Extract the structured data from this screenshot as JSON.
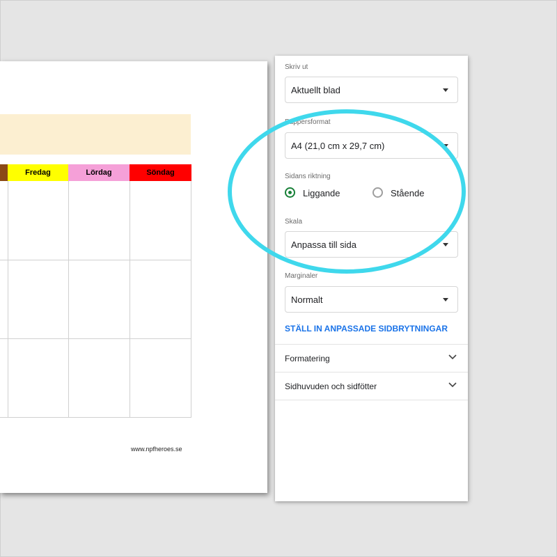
{
  "preview": {
    "days": [
      {
        "label": "",
        "color": "#8b4a17"
      },
      {
        "label": "Fredag",
        "color": "#ffff00"
      },
      {
        "label": "Lördag",
        "color": "#f5a0d8"
      },
      {
        "label": "Söndag",
        "color": "#ff0000"
      }
    ],
    "title_band_color": "#fcefd1",
    "website": "www.npfheroes.se"
  },
  "panel": {
    "print_label": "Skriv ut",
    "print_value": "Aktuellt blad",
    "paper_label": "Pappersformat",
    "paper_value": "A4 (21,0 cm x 29,7 cm)",
    "orientation_label": "Sidans riktning",
    "orientation_options": [
      {
        "label": "Liggande",
        "checked": true
      },
      {
        "label": "Stående",
        "checked": false
      }
    ],
    "scale_label": "Skala",
    "scale_value": "Anpassa till sida",
    "margins_label": "Marginaler",
    "margins_value": "Normalt",
    "page_breaks_link": "STÄLL IN ANPASSADE SIDBRYTNINGAR",
    "sections": [
      "Formatering",
      "Sidhuvuden och sidfötter"
    ]
  },
  "colors": {
    "accent_green": "#188038",
    "link_blue": "#1a73e8",
    "highlight_cyan": "#3fd8ec"
  },
  "icons": {
    "dropdown": "caret-down-icon",
    "expand": "chevron-down-icon"
  }
}
